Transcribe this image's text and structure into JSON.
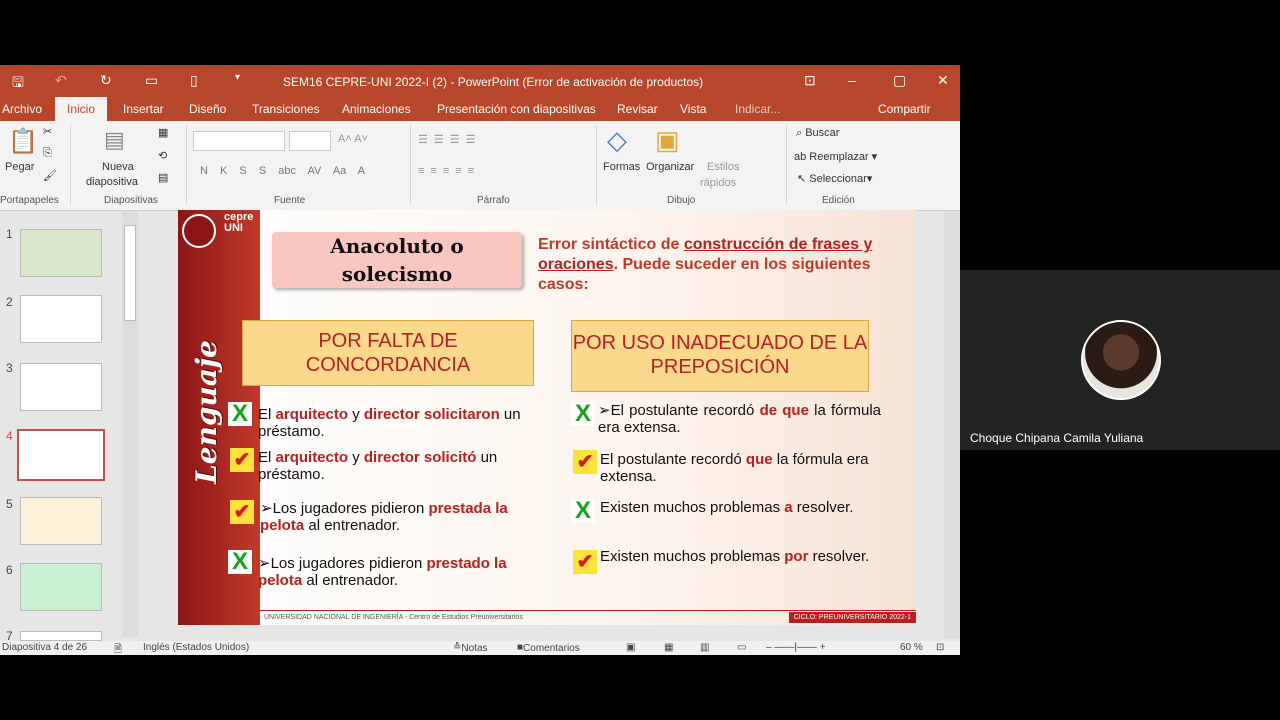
{
  "window": {
    "title": "SEM16 CEPRE-UNI 2022-I (2) - PowerPoint (Error de activación de productos)"
  },
  "tabs": [
    "Archivo",
    "Inicio",
    "Insertar",
    "Diseño",
    "Transiciones",
    "Animaciones",
    "Presentación con diapositivas",
    "Revisar",
    "Vista",
    "Indicar...",
    "Compartir"
  ],
  "ribbon": {
    "pegar": "Pegar",
    "nueva": "Nueva",
    "diapositiva": "diapositiva",
    "formas": "Formas",
    "organizar": "Organizar",
    "estilos": "Estilos",
    "rapidos": "rápidos",
    "buscar": "Buscar",
    "reemplazar": "Reemplazar",
    "seleccionar": "Seleccionar",
    "groups": [
      "Portapapeles",
      "Diapositivas",
      "Fuente",
      "Párrafo",
      "Dibujo",
      "Edición"
    ],
    "font_buttons": [
      "N",
      "K",
      "S",
      "S",
      "abc",
      "AV",
      "Aa",
      "A"
    ]
  },
  "thumbs": [
    "1",
    "2",
    "3",
    "4",
    "5",
    "6",
    "7"
  ],
  "slide": {
    "logo": "cepre UNI",
    "vertical": "Lenguaje",
    "title": "Anacoluto o solecismo",
    "def_a": "Error sintáctico de ",
    "def_u": "construcción de frases y oraciones",
    "def_b": ". Puede suceder en los siguientes casos:",
    "left_header": "POR FALTA DE CONCORDANCIA",
    "right_header": "POR USO INADECUADO DE LA PREPOSICIÓN",
    "l1": {
      "a": "El ",
      "b": "arquitecto",
      "c": " y ",
      "d": "director solicitaron",
      "e": " un préstamo."
    },
    "l2": {
      "a": "El ",
      "b": "arquitecto",
      "c": " y ",
      "d": "director solicitó",
      "e": " un préstamo."
    },
    "l3": {
      "a": "➢Los jugadores pidieron ",
      "b": "prestada la pelota",
      "c": " al entrenador."
    },
    "l4": {
      "a": "➢Los jugadores pidieron ",
      "b": "prestado la pelota",
      "c": " al entrenador."
    },
    "r1": {
      "a": "➢El postulante recordó ",
      "b": "de que",
      "c": " la fórmula era extensa."
    },
    "r2": {
      "a": "El postulante recordó ",
      "b": "que",
      "c": " la fórmula era extensa."
    },
    "r3": {
      "a": "Existen muchos problemas ",
      "b": "a",
      "c": " resolver."
    },
    "r4": {
      "a": "Existen muchos problemas ",
      "b": "por",
      "c": " resolver."
    },
    "footer_left": "UNIVERSIDAD NACIONAL DE INGENIERÍA - Centro de Estudios Preuniversitarios",
    "footer_right": "CICLO: PREUNIVERSITARIO 2022-1"
  },
  "status": {
    "slide": "Diapositiva 4 de 26",
    "lang": "Inglés (Estados Unidos)",
    "notas": "Notas",
    "comentarios": "Comentarios",
    "zoom": "60 %"
  },
  "participant": {
    "name": "Choque Chipana Camila Yuliana"
  }
}
